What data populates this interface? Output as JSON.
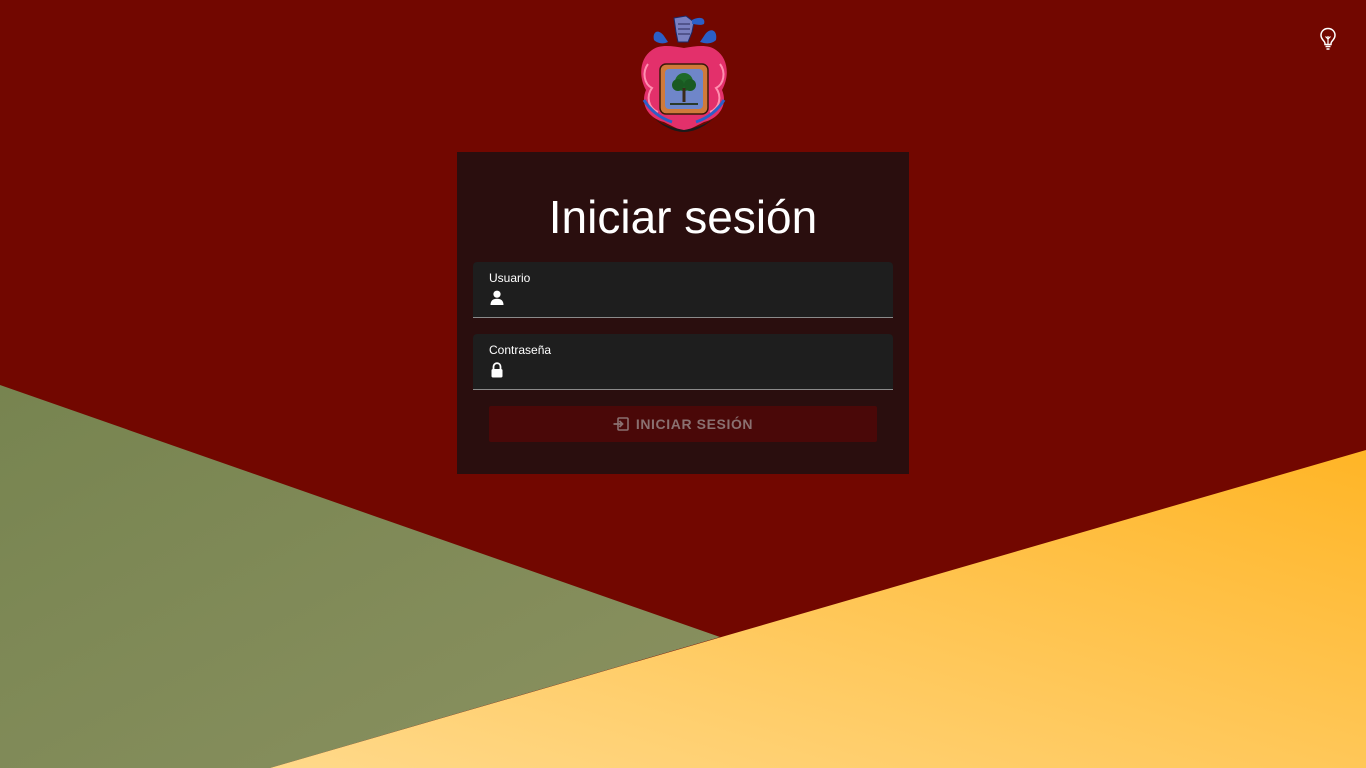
{
  "colors": {
    "background": "#720700",
    "olive_shape": "#7f8a58",
    "yellow_shape": "#ffc13a",
    "card": "#2a0e0e",
    "field": "#1e1e1e",
    "button": "#4a0808",
    "button_text": "#8a7070"
  },
  "header": {
    "theme_toggle_icon": "lightbulb-icon"
  },
  "logo": {
    "icon": "coat-of-arms-crest"
  },
  "login": {
    "title": "Iniciar sesión",
    "username": {
      "label": "Usuario",
      "value": "",
      "icon": "user-icon"
    },
    "password": {
      "label": "Contraseña",
      "value": "",
      "icon": "lock-icon"
    },
    "submit": {
      "label": "INICIAR SESIÓN",
      "icon": "login-icon",
      "disabled": true
    }
  }
}
